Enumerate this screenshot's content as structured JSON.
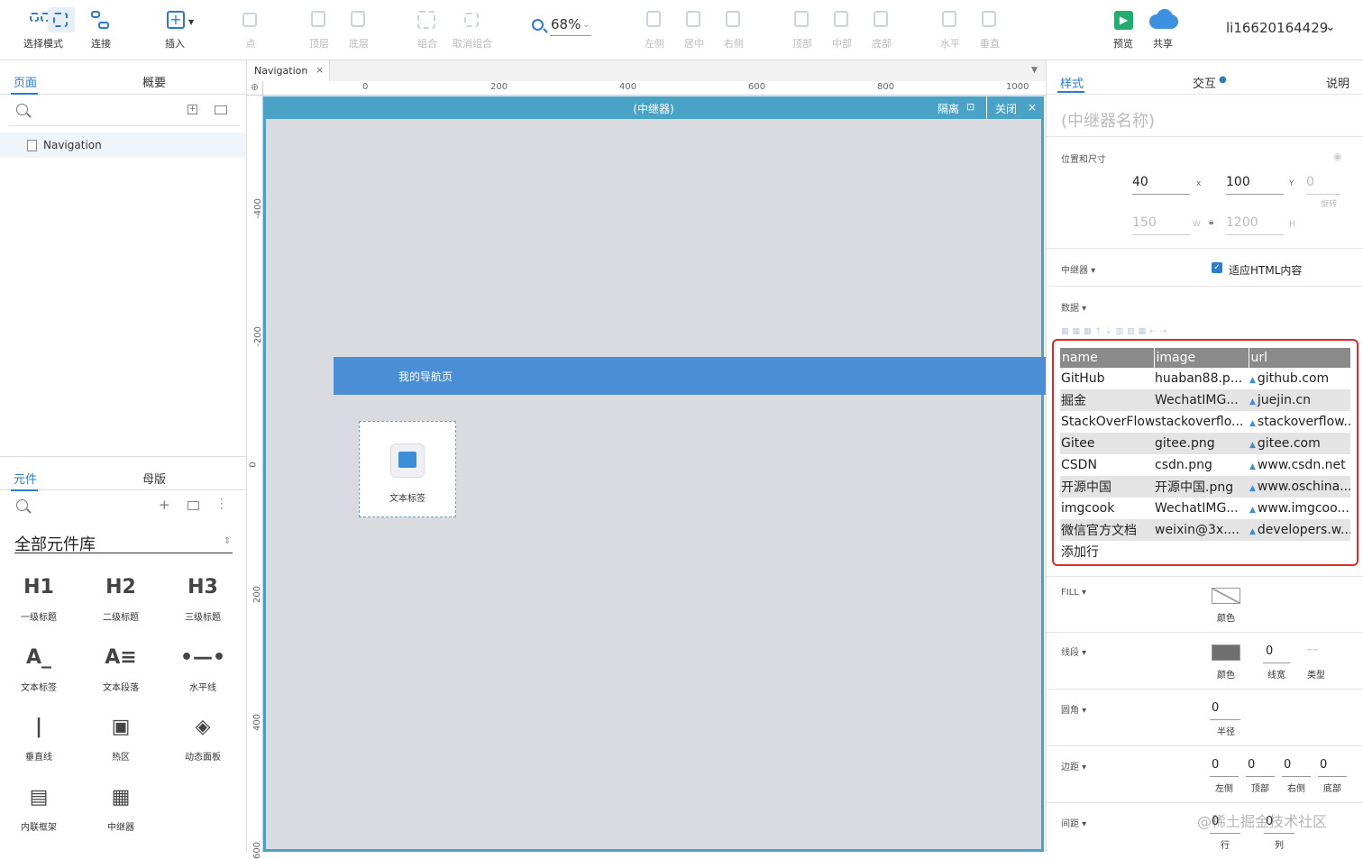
{
  "toolbar": {
    "select_mode": "选择模式",
    "connect": "连接",
    "insert": "插入",
    "point": "点",
    "top_layer": "顶层",
    "bottom_layer": "底层",
    "group": "组合",
    "ungroup": "取消组合",
    "zoom": "68%",
    "align_left": "左侧",
    "align_center": "居中",
    "align_right": "右侧",
    "align_top": "顶部",
    "align_middle": "中部",
    "align_bottom": "底部",
    "dist_h": "水平",
    "dist_v": "垂直",
    "preview": "预览",
    "share": "共享",
    "username": "li16620164429"
  },
  "left": {
    "tab_pages": "页面",
    "tab_outline": "概要",
    "page_name": "Navigation",
    "tab_widgets": "元件",
    "tab_masters": "母版",
    "library_title": "全部元件库",
    "widgets": [
      {
        "glyph": "H1",
        "label": "一级标题"
      },
      {
        "glyph": "H2",
        "label": "二级标题"
      },
      {
        "glyph": "H3",
        "label": "三级标题"
      },
      {
        "glyph": "A_",
        "label": "文本标签"
      },
      {
        "glyph": "A≡",
        "label": "文本段落"
      },
      {
        "glyph": "•—•",
        "label": "水平线"
      },
      {
        "glyph": "|",
        "label": "垂直线"
      },
      {
        "glyph": "▣",
        "label": "热区"
      },
      {
        "glyph": "◈",
        "label": "动态面板"
      },
      {
        "glyph": "▤",
        "label": "内联框架"
      },
      {
        "glyph": "▦",
        "label": "中继器"
      }
    ]
  },
  "canvas": {
    "doc_tab": "Navigation",
    "ruler_h": [
      "0",
      "200",
      "400",
      "600",
      "800",
      "1000"
    ],
    "ruler_v": [
      "-400",
      "-200",
      "0",
      "200",
      "400",
      "600"
    ],
    "repeater_title": "(中继器)",
    "isolate": "隔离",
    "close": "关闭",
    "nav_text": "我的导航页",
    "image_label": "文本标签"
  },
  "right": {
    "tab_style": "样式",
    "tab_interact": "交互",
    "tab_notes": "说明",
    "name_placeholder": "(中继器名称)",
    "pos_size": "位置和尺寸",
    "x": "40",
    "x_lbl": "x",
    "y": "100",
    "y_lbl": "Y",
    "rot": "0",
    "rot_lbl": "旋转",
    "w": "150",
    "w_lbl": "W",
    "h": "1200",
    "h_lbl": "H",
    "repeater_lbl": "中继器 ▾",
    "fit_html": "适应HTML内容",
    "data_lbl": "数据 ▾",
    "columns": [
      "name",
      "image",
      "url"
    ],
    "rows": [
      [
        "GitHub",
        "huaban88.p...",
        "github.com"
      ],
      [
        "掘金",
        "WechatIMG...",
        "juejin.cn"
      ],
      [
        "StackOverFlow",
        "stackoverflo...",
        "stackoverflow..."
      ],
      [
        "Gitee",
        "gitee.png",
        "gitee.com"
      ],
      [
        "CSDN",
        "csdn.png",
        "www.csdn.net"
      ],
      [
        "开源中国",
        "开源中国.png",
        "www.oschina...."
      ],
      [
        "imgcook",
        "WechatIMG...",
        "www.imgcoo..."
      ],
      [
        "微信官方文档",
        "weixin@3x....",
        "developers.w..."
      ]
    ],
    "add_row": "添加行",
    "fill_lbl": "FILL ▾",
    "fill_color": "颜色",
    "stroke_lbl": "线段 ▾",
    "stroke_color": "颜色",
    "stroke_width": "0",
    "stroke_width_lbl": "线宽",
    "stroke_type": "类型",
    "radius_lbl": "圆角 ▾",
    "radius": "0",
    "radius_cap": "半径",
    "padding_lbl": "边距 ▾",
    "pad_left": "0",
    "pad_top": "0",
    "pad_right": "0",
    "pad_bottom": "0",
    "pad_left_lbl": "左侧",
    "pad_top_lbl": "顶部",
    "pad_right_lbl": "右侧",
    "pad_bottom_lbl": "底部",
    "spacing_lbl": "间距 ▾",
    "sp_row": "0",
    "sp_col": "0",
    "sp_row_lbl": "行",
    "sp_col_lbl": "列"
  },
  "watermark": "@稀土掘金技术社区",
  "colors": {
    "accent": "#2b7bd1",
    "repeater": "#4aa3c7",
    "nav": "#4a8ed6",
    "highlight": "#e02a2a"
  }
}
